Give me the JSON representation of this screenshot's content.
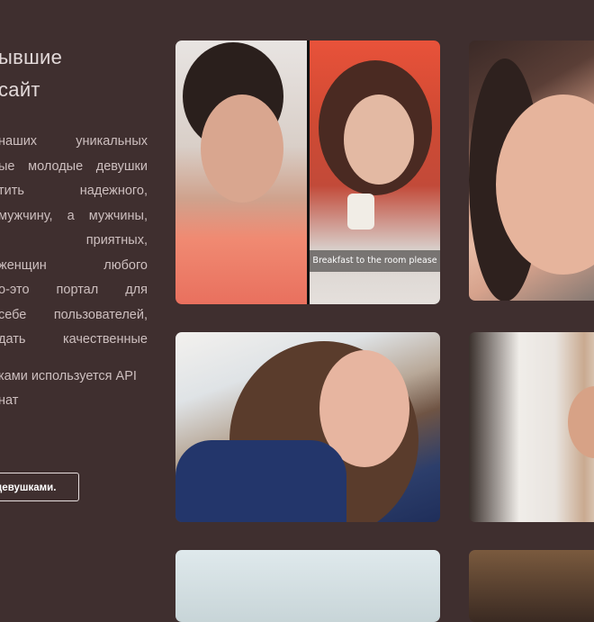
{
  "heading": {
    "line1": "ывшие",
    "line2": "сайт"
  },
  "description": {
    "lines": [
      "наших уникальных",
      "ые молодые девушки",
      "тить надежного,",
      "мужчину, а мужчины,",
      "приятных,",
      "женщин любого",
      "о-это портал для",
      "себе пользователей,",
      "дать качественные"
    ],
    "lines2": [
      "ками используется API",
      "нат"
    ]
  },
  "cta": {
    "label": "девушками."
  },
  "gallery": {
    "caption": "Breakfast to the room please"
  }
}
